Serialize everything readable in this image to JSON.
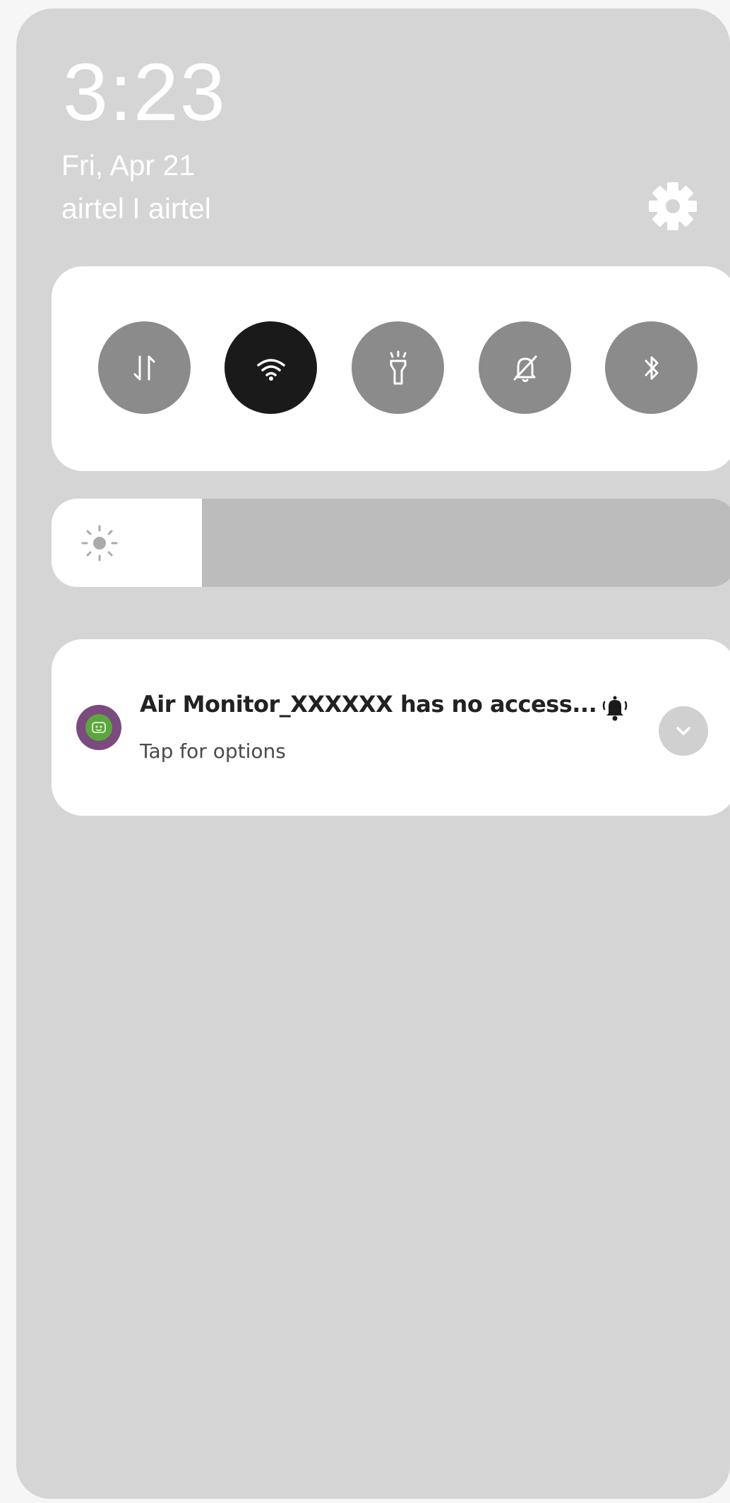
{
  "status": {
    "time": "3:23",
    "date": "Fri, Apr 21",
    "carrier": "airtel I airtel"
  },
  "quick_settings": {
    "tiles": [
      {
        "name": "mobile-data",
        "icon": "data-transfer-arrows-icon",
        "active": false
      },
      {
        "name": "wifi",
        "icon": "wifi-icon",
        "active": true
      },
      {
        "name": "flashlight",
        "icon": "flashlight-icon",
        "active": false
      },
      {
        "name": "mute",
        "icon": "bell-off-icon",
        "active": false
      },
      {
        "name": "bluetooth",
        "icon": "bluetooth-icon",
        "active": false
      }
    ]
  },
  "brightness": {
    "level_percent": 22,
    "icon": "sun-icon"
  },
  "notification": {
    "title": "Air Monitor_XXXXXX has no access...",
    "subtitle": "Tap for options",
    "app_icon": "air-monitor-app-icon",
    "alert_icon": "bell-ringing-icon",
    "expand_icon": "chevron-down-icon"
  },
  "colors": {
    "panel": "#d5d5d5",
    "tile_inactive": "#8b8b8b",
    "tile_active": "#1a1a1a",
    "app_icon_bg": "#7b4a7e",
    "app_icon_fg": "#5aa63f"
  }
}
